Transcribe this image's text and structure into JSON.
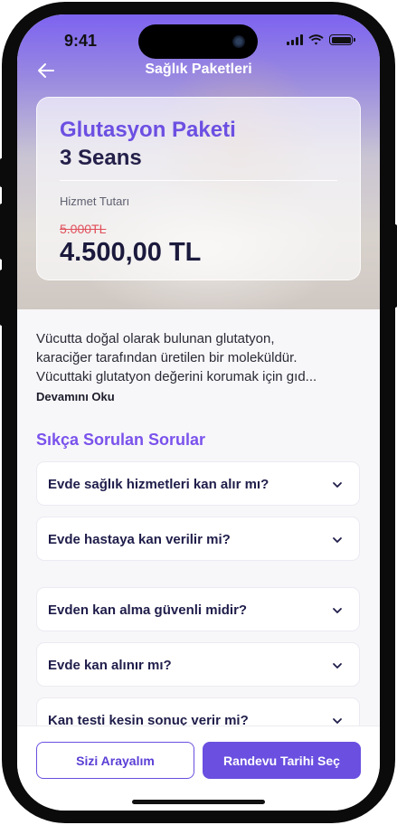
{
  "status_bar": {
    "time": "9:41"
  },
  "nav": {
    "title": "Sağlık Paketleri"
  },
  "package": {
    "name": "Glutasyon Paketi",
    "sessions": "3 Seans",
    "price_label": "Hizmet Tutarı",
    "old_price": "5.000TL",
    "new_price": "4.500,00 TL"
  },
  "description": {
    "lines": [
      "Vücutta doğal olarak bulunan glutatyon,",
      "karaciğer tarafından üretilen bir moleküldür.",
      "Vücuttaki glutatyon değerini korumak için gıd..."
    ],
    "read_more": "Devamını Oku"
  },
  "faq": {
    "title": "Sıkça Sorulan Sorular",
    "items": [
      {
        "question": "Evde sağlık hizmetleri kan alır mı?"
      },
      {
        "question": "Evde hastaya kan verilir mi?"
      },
      {
        "question": "Evden kan alma güvenli midir?"
      },
      {
        "question": "Evde kan alınır mı?"
      },
      {
        "question": "Kan testi kesin sonuç verir mi?"
      }
    ]
  },
  "actions": {
    "call_me": "Sizi Arayalım",
    "pick_date": "Randevu Tarihi Seç"
  },
  "colors": {
    "accent": "#6a4fe0",
    "title_purple": "#7a52ec",
    "old_price_red": "#e0505b",
    "dark_text": "#1f1d4a"
  },
  "icons": {
    "back": "arrow-left-icon",
    "faq_toggle": "chevron-down-icon",
    "signal": "signal-icon",
    "wifi": "wifi-icon",
    "battery": "battery-icon"
  }
}
